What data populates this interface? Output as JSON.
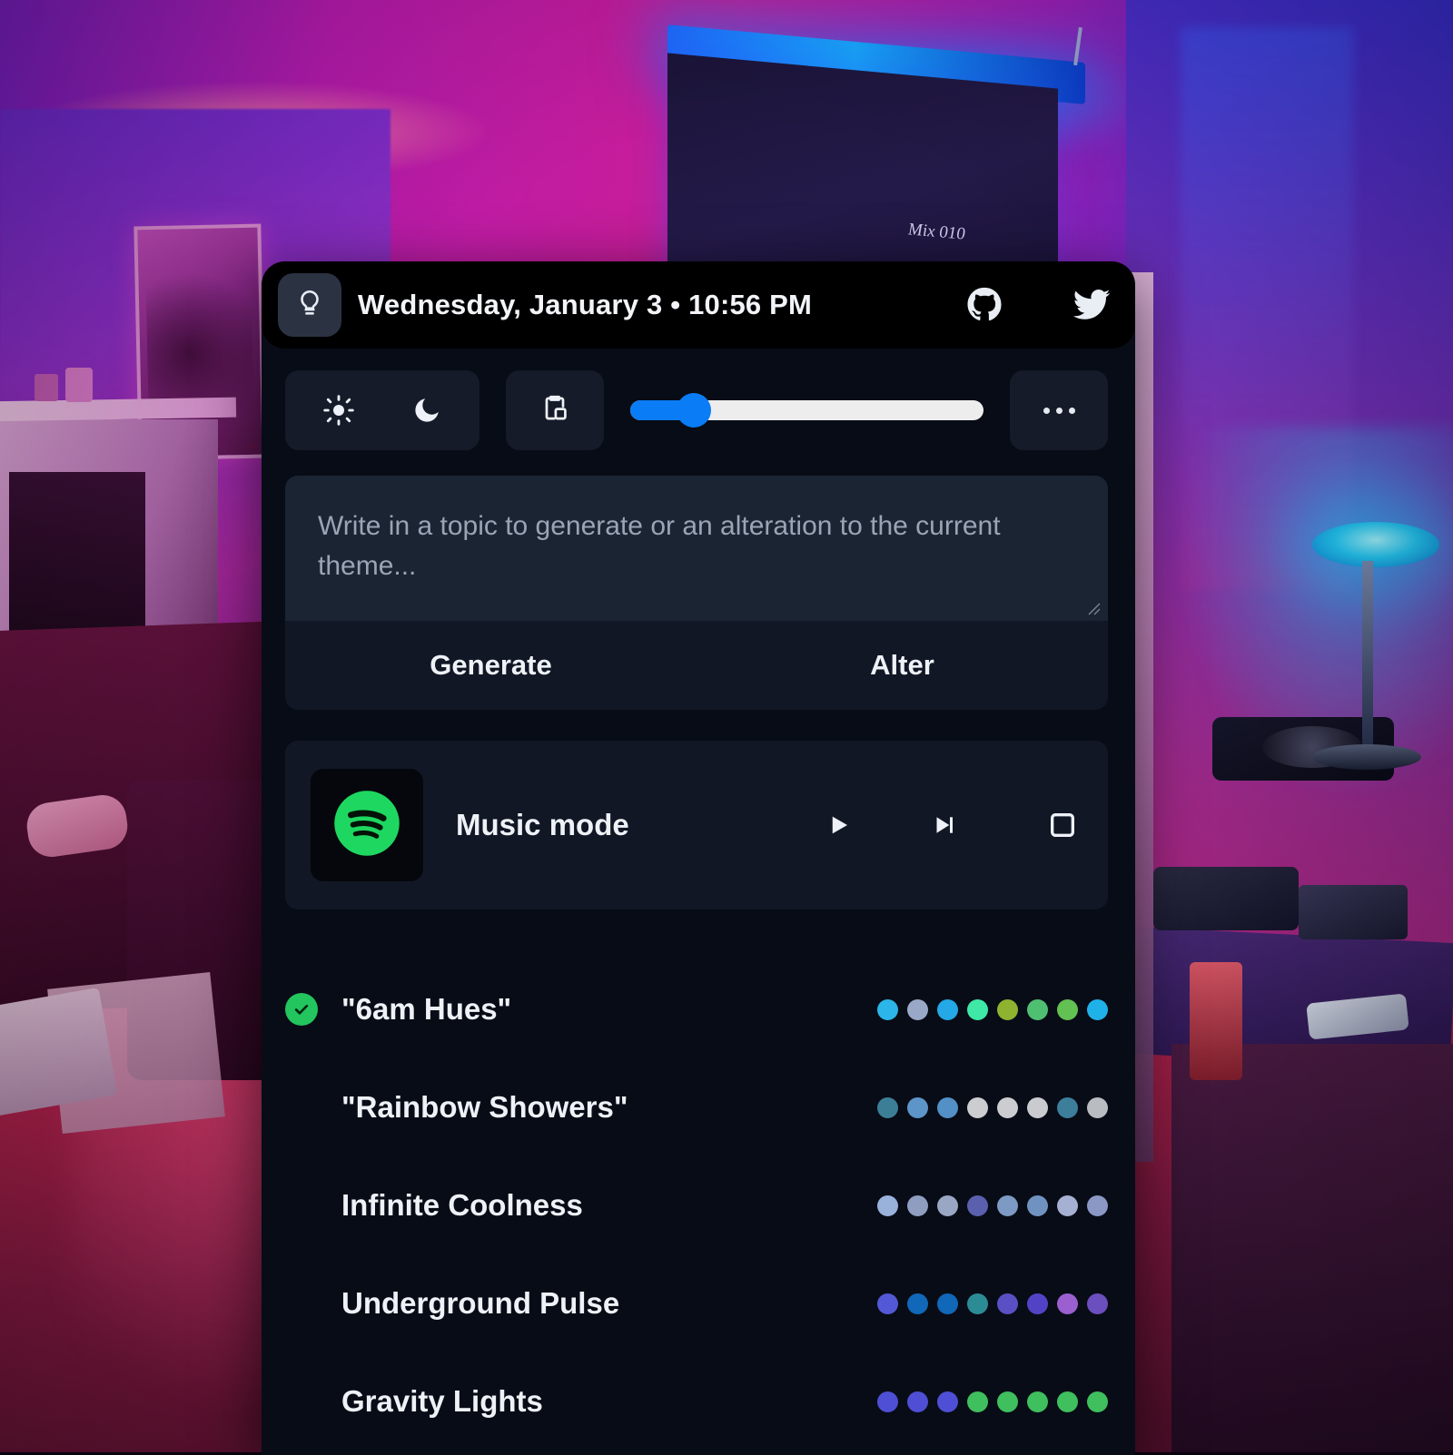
{
  "background": {
    "description": "photo of a living room lit by colored smart lights",
    "mix_label": "Mix 010"
  },
  "header": {
    "app_icon": "lightbulb-icon",
    "title": "Wednesday, January 3 • 10:56 PM",
    "links": [
      {
        "name": "github-icon",
        "label": "GitHub"
      },
      {
        "name": "twitter-icon",
        "label": "Twitter"
      }
    ]
  },
  "toolbar": {
    "brightness_icon": "sun-icon",
    "night_icon": "moon-icon",
    "copy_icon": "clipboard-paste-icon",
    "more_icon": "ellipsis-icon",
    "slider": {
      "name": "brightness-slider",
      "value": 18,
      "min": 0,
      "max": 100,
      "fill_color": "#0a7cf5",
      "track_color": "#ededed"
    }
  },
  "prompt": {
    "placeholder": "Write in a topic to generate or an alteration to the current theme...",
    "value": "",
    "generate_label": "Generate",
    "alter_label": "Alter"
  },
  "music": {
    "provider_icon": "spotify-icon",
    "label": "Music mode",
    "accent_color": "#1ed760",
    "controls": [
      {
        "name": "play-button",
        "icon": "play-icon"
      },
      {
        "name": "next-button",
        "icon": "skip-next-icon"
      },
      {
        "name": "stop-button",
        "icon": "stop-square-icon"
      }
    ]
  },
  "themes": [
    {
      "name": "\"6am Hues\"",
      "active": true,
      "swatches": [
        "#2bb5e8",
        "#9aa8c8",
        "#24a8e6",
        "#3fe8a6",
        "#8fb330",
        "#4fbf72",
        "#63c052",
        "#1fb2e8"
      ]
    },
    {
      "name": "\"Rainbow Showers\"",
      "active": false,
      "swatches": [
        "#3d7e97",
        "#5d95c9",
        "#5290c6",
        "#cbcdd0",
        "#cbcdd0",
        "#c9cbce",
        "#3d7e9b",
        "#b9bcc0"
      ]
    },
    {
      "name": "Infinite Coolness",
      "active": false,
      "swatches": [
        "#99b2dc",
        "#8e9dc0",
        "#9aa7c4",
        "#5a5fae",
        "#7c9ac4",
        "#7092c0",
        "#a6b0d2",
        "#8b97c4"
      ]
    },
    {
      "name": "Underground Pulse",
      "active": false,
      "swatches": [
        "#5358d6",
        "#1167b8",
        "#1167b8",
        "#2c8c96",
        "#5b4fc4",
        "#5243c6",
        "#9b5fd0",
        "#6b4fbe"
      ]
    },
    {
      "name": "Gravity Lights",
      "active": false,
      "swatches": [
        "#4e4fd4",
        "#4e4fd4",
        "#4e4fd4",
        "#3fbf5e",
        "#3fbf5e",
        "#3fbf5e",
        "#3fbf5e",
        "#3fbf5e"
      ]
    }
  ]
}
